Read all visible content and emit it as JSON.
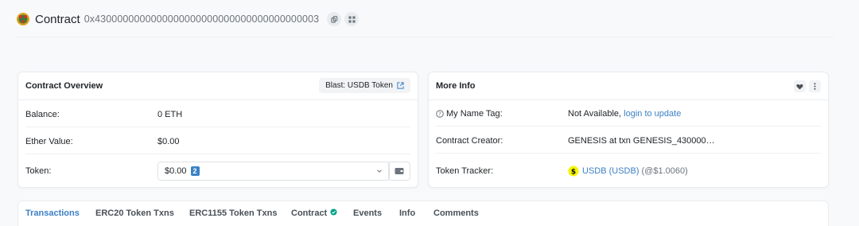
{
  "header": {
    "title": "Contract",
    "address": "0x4300000000000000000000000000000000000003",
    "copy_icon": "copy-icon",
    "qr_icon": "qr-code-icon"
  },
  "overview": {
    "title": "Contract Overview",
    "tag_label": "Blast: USDB Token",
    "rows": {
      "balance": {
        "label": "Balance:",
        "value": "0 ETH"
      },
      "ether_value": {
        "label": "Ether Value:",
        "value": "$0.00"
      },
      "token": {
        "label": "Token:",
        "value": "$0.00",
        "count": "2"
      }
    }
  },
  "more_info": {
    "title": "More Info",
    "rows": {
      "name_tag": {
        "label": "My Name Tag:",
        "value": "Not Available,",
        "link": "login to update"
      },
      "creator": {
        "label": "Contract Creator:",
        "value": "GENESIS at txn GENESIS_430000…"
      },
      "tracker": {
        "label": "Token Tracker:",
        "link": "USDB (USDB)",
        "price": "(@$1.0060)"
      }
    }
  },
  "tabs": [
    {
      "label": "Transactions",
      "active": true
    },
    {
      "label": "ERC20 Token Txns",
      "active": false
    },
    {
      "label": "ERC1155 Token Txns",
      "active": false
    },
    {
      "label": "Contract",
      "active": false,
      "verified": true
    },
    {
      "label": "Events",
      "active": false
    },
    {
      "label": "Info",
      "active": false
    },
    {
      "label": "Comments",
      "active": false
    }
  ],
  "colors": {
    "accent": "#3b7fc4",
    "verified": "#00a186",
    "token_icon_bg": "#f5f500"
  }
}
